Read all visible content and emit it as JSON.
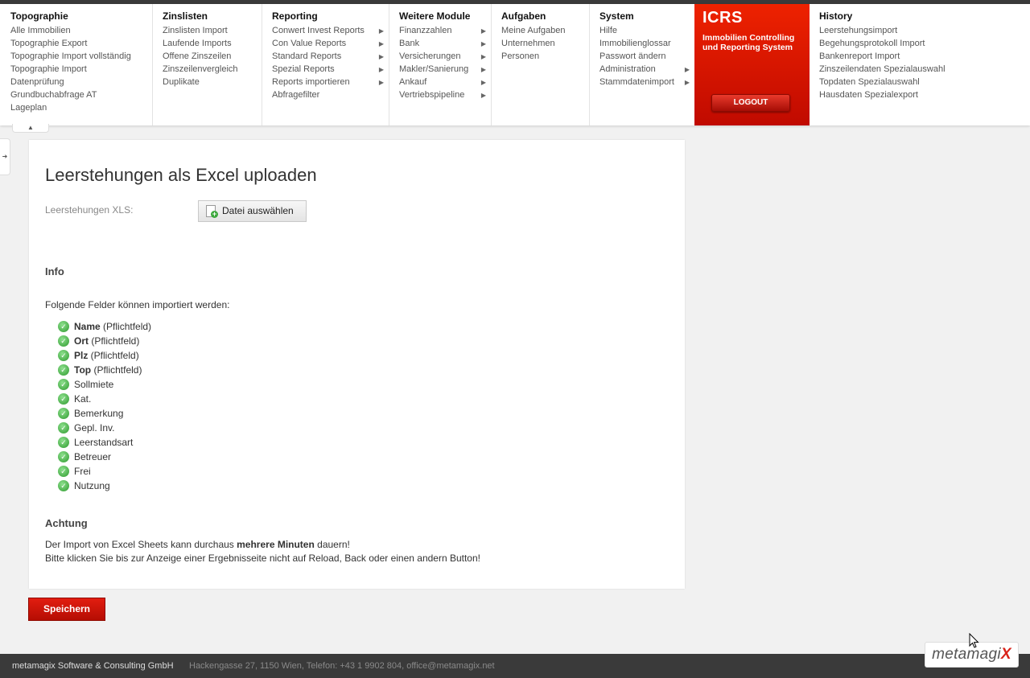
{
  "menu": {
    "topographie": {
      "title": "Topographie",
      "items": [
        "Alle Immobilien",
        "Topographie Export",
        "Topographie Import vollständig",
        "Topographie Import",
        "Datenprüfung",
        "Grundbuchabfrage AT",
        "Lageplan"
      ]
    },
    "zinslisten": {
      "title": "Zinslisten",
      "items": [
        "Zinslisten Import",
        "Laufende Imports",
        "Offene Zinszeilen",
        "Zinszeilenvergleich",
        "Duplikate"
      ]
    },
    "reporting": {
      "title": "Reporting",
      "items": [
        "Conwert Invest Reports",
        "Con Value Reports",
        "Standard Reports",
        "Spezial Reports",
        "Reports importieren",
        "Abfragefilter"
      ]
    },
    "weitere": {
      "title": "Weitere Module",
      "items": [
        "Finanzzahlen",
        "Bank",
        "Versicherungen",
        "Makler/Sanierung",
        "Ankauf",
        "Vertriebspipeline"
      ]
    },
    "aufgaben": {
      "title": "Aufgaben",
      "items": [
        "Meine Aufgaben",
        "Unternehmen",
        "Personen"
      ]
    },
    "system": {
      "title": "System",
      "items": [
        "Hilfe",
        "Immobilienglossar",
        "Passwort ändern",
        "Administration",
        "Stammdatenimport"
      ]
    },
    "history": {
      "title": "History",
      "items": [
        "Leerstehungsimport",
        "Begehungsprotokoll Import",
        "Bankenreport Import",
        "Zinszeilendaten Spezialauswahl",
        "Topdaten Spezialauswahl",
        "Hausdaten Spezialexport"
      ]
    }
  },
  "icrs": {
    "logo": "ICRS",
    "tagline": "Immobilien Controlling und Reporting System",
    "logout_label": "LOGOUT"
  },
  "main": {
    "title": "Leerstehungen als Excel uploaden",
    "file_label": "Leerstehungen XLS:",
    "file_button": "Datei auswählen",
    "info_heading": "Info",
    "info_intro": "Folgende Felder können importiert werden:",
    "fields": [
      {
        "name": "Name",
        "note": " (Pflichtfeld)"
      },
      {
        "name": "Ort",
        "note": " (Pflichtfeld)"
      },
      {
        "name": "Plz",
        "note": " (Pflichtfeld)"
      },
      {
        "name": "Top",
        "note": " (Pflichtfeld)"
      },
      {
        "name": "",
        "note": "Sollmiete"
      },
      {
        "name": "",
        "note": "Kat."
      },
      {
        "name": "",
        "note": "Bemerkung"
      },
      {
        "name": "",
        "note": "Gepl. Inv."
      },
      {
        "name": "",
        "note": "Leerstandsart"
      },
      {
        "name": "",
        "note": "Betreuer"
      },
      {
        "name": "",
        "note": "Frei"
      },
      {
        "name": "",
        "note": "Nutzung"
      }
    ],
    "warning_heading": "Achtung",
    "warning_pre": "Der Import von Excel Sheets kann durchaus ",
    "warning_bold": "mehrere Minuten",
    "warning_post": " dauern!",
    "warning_line2": "Bitte klicken Sie bis zur Anzeige einer Ergebnisseite nicht auf Reload, Back oder einen andern Button!"
  },
  "save_label": "Speichern",
  "footer": {
    "company": "metamagix Software & Consulting GmbH",
    "address": "Hackengasse 27, 1150 Wien, Telefon: +43 1 9902 804, office@metamagix.net"
  },
  "brand": {
    "text": "metamagi",
    "x": "X"
  }
}
